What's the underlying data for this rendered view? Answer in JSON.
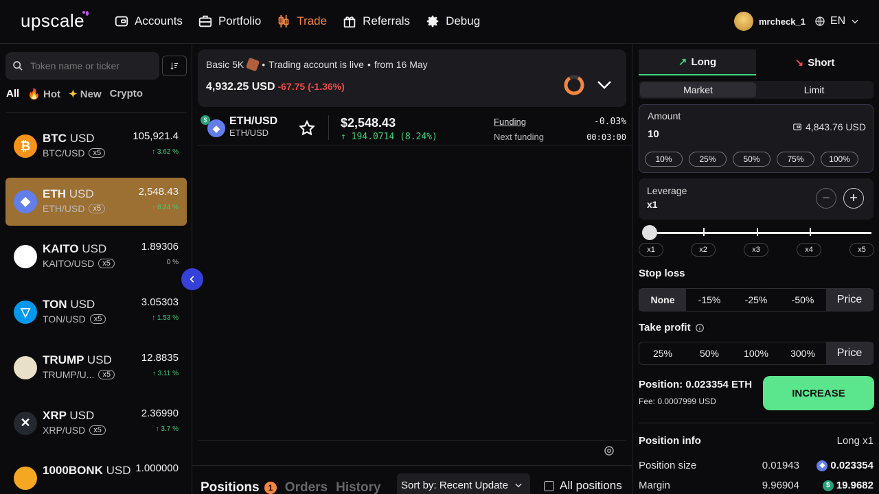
{
  "header": {
    "logo": "upscale",
    "nav": [
      {
        "label": "Accounts",
        "icon": "wallet-icon"
      },
      {
        "label": "Portfolio",
        "icon": "briefcase-icon"
      },
      {
        "label": "Trade",
        "icon": "candles-icon",
        "active": true
      },
      {
        "label": "Referrals",
        "icon": "gift-icon"
      },
      {
        "label": "Debug",
        "icon": "gear-icon"
      }
    ],
    "username": "mrcheck_1",
    "language": "EN"
  },
  "sidebar": {
    "search_placeholder": "Token name or ticker",
    "filters": [
      "All",
      "Hot",
      "New",
      "Crypto"
    ],
    "tokens": [
      {
        "symbol": "BTC",
        "quote": "USD",
        "pair": "BTC/USD",
        "leverage": "x5",
        "price": "105,921.4",
        "change": "↑ 3.62 %",
        "color": "#f7931a",
        "glyph": "₿"
      },
      {
        "symbol": "ETH",
        "quote": "USD",
        "pair": "ETH/USD",
        "leverage": "x5",
        "price": "2,548.43",
        "change": "↑ 8.24 %",
        "color": "#627eea",
        "glyph": "◆",
        "active": true
      },
      {
        "symbol": "KAITO",
        "quote": "USD",
        "pair": "KAITO/USD",
        "leverage": "x5",
        "price": "1.89306",
        "change": "0 %",
        "color": "#ffffff",
        "glyph": ""
      },
      {
        "symbol": "TON",
        "quote": "USD",
        "pair": "TON/USD",
        "leverage": "x5",
        "price": "3.05303",
        "change": "↑ 1.53 %",
        "color": "#0098ea",
        "glyph": "▽"
      },
      {
        "symbol": "TRUMP",
        "quote": "USD",
        "pair": "TRUMP/U...",
        "leverage": "x5",
        "price": "12.8835",
        "change": "↑ 3.11 %",
        "color": "#e8e0c8",
        "glyph": ""
      },
      {
        "symbol": "XRP",
        "quote": "USD",
        "pair": "XRP/USD",
        "leverage": "x5",
        "price": "2.36990",
        "change": "↑ 3.7 %",
        "color": "#23292f",
        "glyph": "✕"
      },
      {
        "symbol": "1000BONK",
        "quote": "USD",
        "pair": "",
        "leverage": "",
        "price": "1.000000",
        "change": "",
        "color": "#f5a623",
        "glyph": ""
      }
    ]
  },
  "account": {
    "name": "Basic 5K",
    "status": "Trading account is live",
    "since": "from 16 May",
    "balance": "4,932.25 USD",
    "pnl": "-67.75 (-1.36%)"
  },
  "pair": {
    "name": "ETH/USD",
    "sub": "ETH/USD",
    "price": "$2,548.43",
    "change": "194.0714 (8.24%)",
    "funding_label": "Funding",
    "funding_value": "-0.03%",
    "next_funding_label": "Next funding",
    "next_funding_value": "00:03:00"
  },
  "bottom": {
    "tabs": [
      "Positions",
      "Orders",
      "History"
    ],
    "positions_count": "1",
    "sort_label": "Sort by: Recent Update",
    "all_positions": "All positions"
  },
  "order": {
    "long_label": "Long",
    "short_label": "Short",
    "market_label": "Market",
    "limit_label": "Limit",
    "amount_label": "Amount",
    "amount_value": "10",
    "balance": "4,843.76 USD",
    "percentages": [
      "10%",
      "25%",
      "50%",
      "75%",
      "100%"
    ],
    "leverage_label": "Leverage",
    "leverage_value": "x1",
    "leverage_level": 0,
    "leverage_marks": [
      "x1",
      "x2",
      "x3",
      "x4",
      "x5"
    ],
    "stop_loss_label": "Stop loss",
    "stop_loss_options": [
      "None",
      "-15%",
      "-25%",
      "-50%",
      "Price"
    ],
    "take_profit_label": "Take profit",
    "take_profit_options": [
      "25%",
      "50%",
      "100%",
      "300%",
      "Price"
    ],
    "position": "Position: 0.023354 ETH",
    "fee": "Fee: 0.0007999 USD",
    "increase_label": "INCREASE"
  },
  "position_info": {
    "title": "Position info",
    "mode": "Long x1",
    "rows": [
      {
        "label": "Position size",
        "value1": "0.01943",
        "value2": "0.023354",
        "coin": "eth"
      },
      {
        "label": "Margin",
        "value1": "9.96904",
        "value2": "19.9682",
        "coin": "usd"
      }
    ]
  },
  "colors": {
    "accent": "#f5853f",
    "positive": "#3ed47b",
    "negative": "#f04b4b",
    "increase": "#5be58d",
    "active_token": "#9c6f32"
  }
}
